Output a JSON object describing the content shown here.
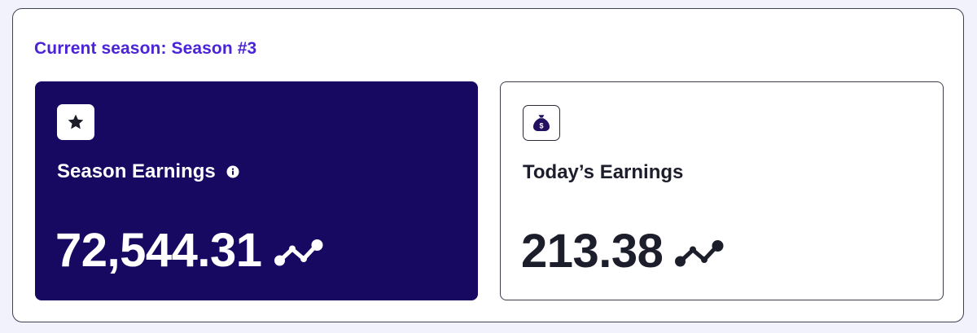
{
  "season": {
    "title": "Current season: Season #3"
  },
  "cards": {
    "season_earnings": {
      "label": "Season Earnings",
      "value": "72,544.31",
      "icon": "star-icon",
      "has_info": true
    },
    "today_earnings": {
      "label": "Today’s Earnings",
      "value": "213.38",
      "icon": "money-bag-icon"
    }
  },
  "colors": {
    "accent": "#4a24d6",
    "season_card_bg": "#170862",
    "page_bg": "#f1f2fc",
    "text_dark": "#1d1e2c"
  }
}
